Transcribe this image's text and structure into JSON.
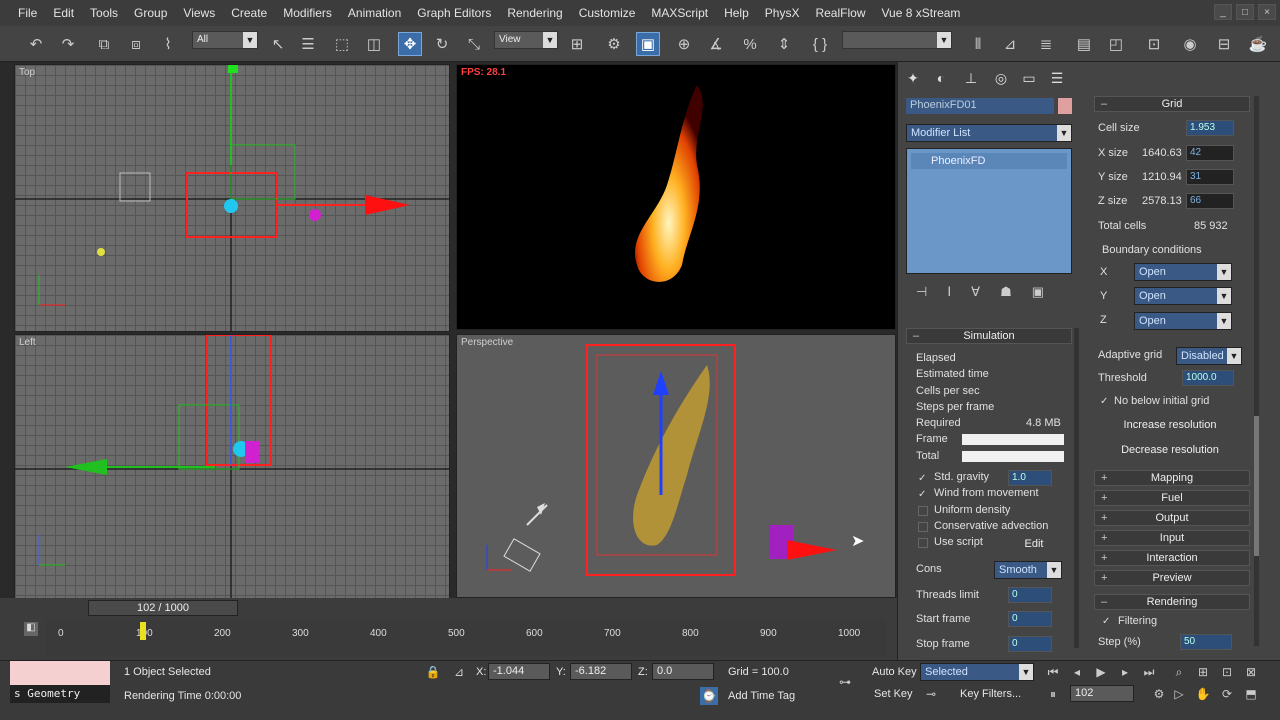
{
  "menu": [
    "File",
    "Edit",
    "Tools",
    "Group",
    "Views",
    "Create",
    "Modifiers",
    "Animation",
    "Graph Editors",
    "Rendering",
    "Customize",
    "MAXScript",
    "Help",
    "PhysX",
    "RealFlow",
    "Vue 8 xStream"
  ],
  "toolbar": {
    "selection_filter": "All",
    "ref_coord": "View"
  },
  "viewports": {
    "top": "Top",
    "left": "Left",
    "perspective": "Perspective",
    "fps": "FPS: 28.1"
  },
  "modify": {
    "object_name": "PhoenixFD01",
    "modifier_list": "Modifier List",
    "stack_item": "PhoenixFD"
  },
  "grid": {
    "title": "Grid",
    "cell_size_label": "Cell size",
    "cell_size": "1.953",
    "x_label": "X size",
    "x_world": "1640.63",
    "x_cells": "42",
    "y_label": "Y size",
    "y_world": "1210.94",
    "y_cells": "31",
    "z_label": "Z size",
    "z_world": "2578.13",
    "z_cells": "66",
    "total_label": "Total cells",
    "total": "85 932",
    "boundary_label": "Boundary conditions",
    "bx_label": "X",
    "bx": "Open",
    "by_label": "Y",
    "by": "Open",
    "bz_label": "Z",
    "bz": "Open",
    "adaptive_label": "Adaptive grid",
    "adaptive": "Disabled",
    "threshold_label": "Threshold",
    "threshold": "1000.0",
    "no_below": "No below initial grid",
    "increase": "Increase resolution",
    "decrease": "Decrease resolution"
  },
  "rollouts": [
    "Mapping",
    "Fuel",
    "Output",
    "Input",
    "Interaction",
    "Preview"
  ],
  "rendering": {
    "title": "Rendering",
    "filtering": "Filtering",
    "step_label": "Step (%)",
    "step": "50"
  },
  "simulation": {
    "title": "Simulation",
    "elapsed": "Elapsed",
    "estimated": "Estimated time",
    "cells_sec": "Cells per sec",
    "steps_frame": "Steps per frame",
    "required": "Required",
    "required_val": "4.8 MB",
    "frame": "Frame",
    "total": "Total",
    "std_gravity": "Std. gravity",
    "gravity_val": "1.0",
    "wind": "Wind from movement",
    "uniform": "Uniform density",
    "conservative": "Conservative advection",
    "use_script": "Use script",
    "edit": "Edit",
    "cons_label": "Cons",
    "cons_val": "Smooth",
    "threads_label": "Threads limit",
    "threads_val": "0",
    "start_label": "Start frame",
    "start_val": "0",
    "stop_label": "Stop frame",
    "stop_val": "0"
  },
  "timeline": {
    "frame_slider": "102 / 1000",
    "ticks": [
      "0",
      "100",
      "200",
      "300",
      "400",
      "500",
      "600",
      "700",
      "800",
      "900",
      "1000"
    ]
  },
  "status": {
    "geometry": "s Geometry",
    "selected": "1 Object Selected",
    "render_time": "Rendering Time  0:00:00",
    "x_label": "X:",
    "x": "-1.044",
    "y_label": "Y:",
    "y": "-6.182",
    "z_label": "Z:",
    "z": "0.0",
    "grid": "Grid = 100.0",
    "add_time_tag": "Add Time Tag",
    "auto_key": "Auto Key",
    "selected_dd": "Selected",
    "set_key": "Set Key",
    "key_filters": "Key Filters...",
    "frame": "102"
  },
  "colors": {
    "accent": "#3b6ea8",
    "selection_red": "#ff2020",
    "panel": "#444444"
  }
}
